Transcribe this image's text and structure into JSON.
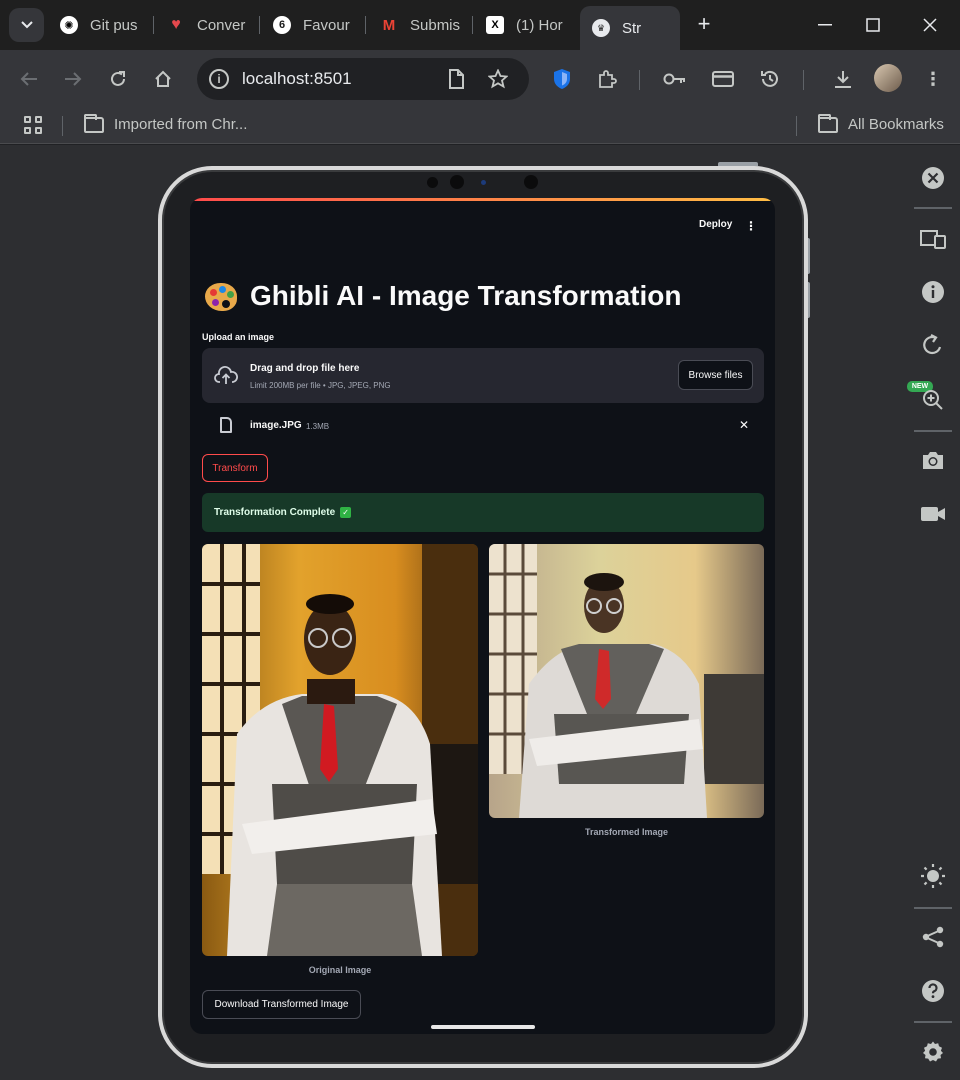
{
  "browser": {
    "tabs": [
      {
        "label": "Git pus",
        "icon": "openai-icon"
      },
      {
        "label": "Conver",
        "icon": "chat-heart-icon"
      },
      {
        "label": "Favour",
        "icon": "favour-icon"
      },
      {
        "label": "Submis",
        "icon": "gmail-icon"
      },
      {
        "label": "(1) Hor",
        "icon": "x-icon"
      },
      {
        "label": "Str",
        "icon": "streamlit-icon",
        "active": true
      }
    ],
    "url": "localhost:8501",
    "bookmarks": {
      "imported": "Imported from Chr...",
      "all": "All Bookmarks"
    }
  },
  "app": {
    "deploy_label": "Deploy",
    "menu_glyph": "⋮",
    "title": "Ghibli AI - Image Transformation",
    "uploader": {
      "label": "Upload an image",
      "drop_title": "Drag and drop file here",
      "drop_limit": "Limit 200MB per file • JPG, JPEG, PNG",
      "browse_label": "Browse files"
    },
    "file": {
      "name": "image.JPG",
      "size": "1.3MB"
    },
    "transform_label": "Transform",
    "success_message": "Transformation Complete",
    "captions": {
      "original": "Original Image",
      "transformed": "Transformed Image"
    },
    "download_label": "Download Transformed Image"
  },
  "devtools": {
    "new_badge": "NEW"
  },
  "colors": {
    "accent": "#ff4b4b",
    "success_bg": "#173928",
    "app_bg": "#0e1117"
  }
}
